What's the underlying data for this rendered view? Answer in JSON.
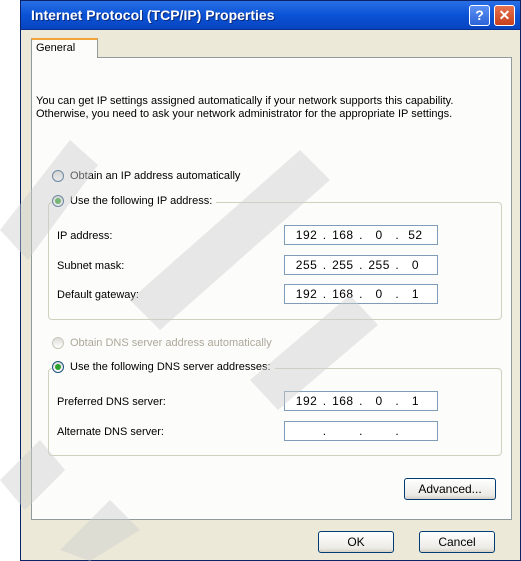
{
  "window": {
    "title": "Internet Protocol (TCP/IP) Properties",
    "help_label": "?",
    "close_label": "✕"
  },
  "tabs": [
    {
      "label": "General"
    }
  ],
  "description": "You can get IP settings assigned automatically if your network supports this capability. Otherwise, you need to ask your network administrator for the appropriate IP settings.",
  "ip": {
    "auto_label": "Obtain an IP address automatically",
    "manual_label": "Use the following IP address:",
    "selected": "manual",
    "fields": [
      {
        "label": "IP address:",
        "octets": [
          "192",
          "168",
          "0",
          "52"
        ]
      },
      {
        "label": "Subnet mask:",
        "octets": [
          "255",
          "255",
          "255",
          "0"
        ]
      },
      {
        "label": "Default gateway:",
        "octets": [
          "192",
          "168",
          "0",
          "1"
        ]
      }
    ]
  },
  "dns": {
    "auto_label": "Obtain DNS server address automatically",
    "manual_label": "Use the following DNS server addresses:",
    "selected": "manual",
    "fields": [
      {
        "label": "Preferred DNS server:",
        "octets": [
          "192",
          "168",
          "0",
          "1"
        ]
      },
      {
        "label": "Alternate DNS server:",
        "octets": [
          "",
          "",
          "",
          ""
        ]
      }
    ]
  },
  "buttons": {
    "advanced": "Advanced...",
    "ok": "OK",
    "cancel": "Cancel"
  },
  "colors": {
    "titlebar": "#0a53d6",
    "dialog_bg": "#ece9d8",
    "selected_radio": "#2fa02f",
    "tab_highlight": "#f2a33a"
  }
}
